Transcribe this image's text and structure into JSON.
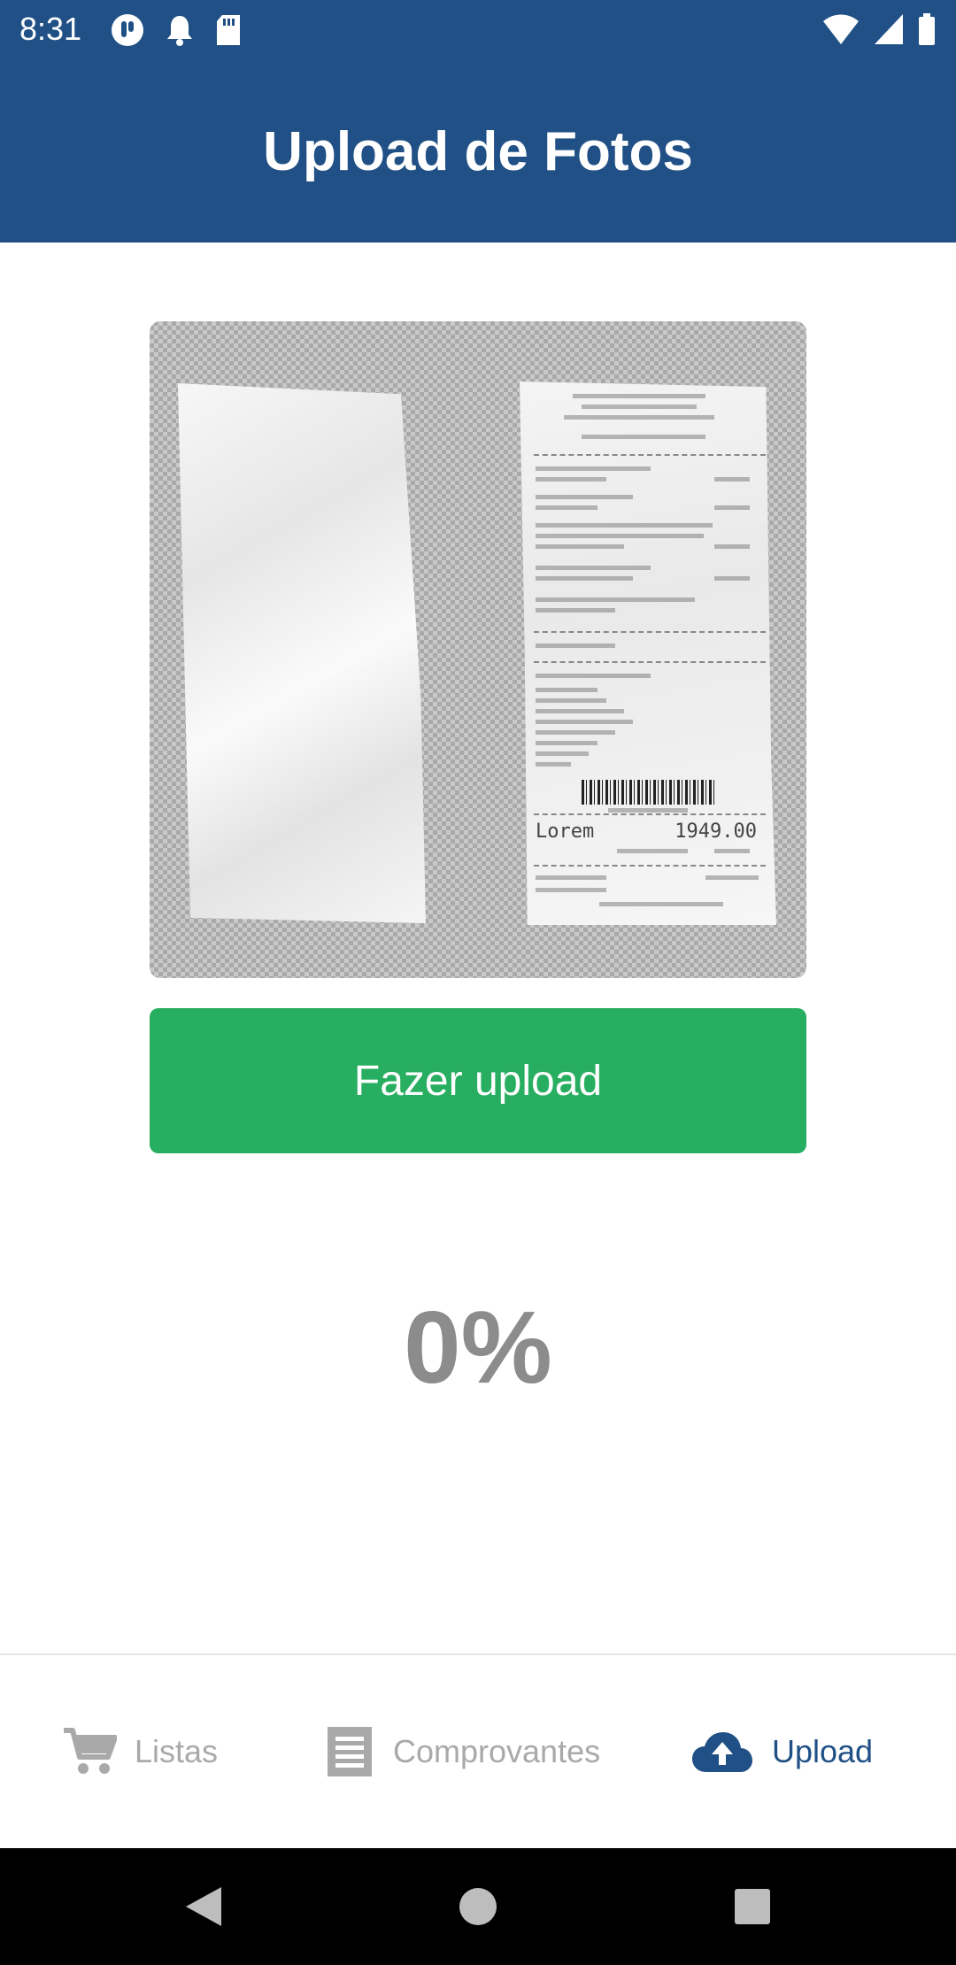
{
  "status_bar": {
    "time": "8:31",
    "icons": [
      "app-notification-icon",
      "bell-icon",
      "sd-card-icon",
      "wifi-icon",
      "signal-icon",
      "battery-icon"
    ]
  },
  "app_bar": {
    "title": "Upload de Fotos"
  },
  "photo": {
    "receipt_total_label": "Lorem",
    "receipt_total_value": "1949.00"
  },
  "upload_button": {
    "label": "Fazer upload"
  },
  "progress": {
    "text": "0%"
  },
  "tabs": [
    {
      "label": "Listas",
      "icon": "cart-icon",
      "active": false
    },
    {
      "label": "Comprovantes",
      "icon": "receipt-icon",
      "active": false
    },
    {
      "label": "Upload",
      "icon": "cloud-upload-icon",
      "active": true
    }
  ],
  "colors": {
    "primary": "#205086",
    "success": "#27ae60",
    "inactive": "#a9a9a9",
    "progress_text": "#8c8c8c"
  },
  "nav_bar": {
    "icons": [
      "back-icon",
      "home-icon",
      "recents-icon"
    ]
  }
}
